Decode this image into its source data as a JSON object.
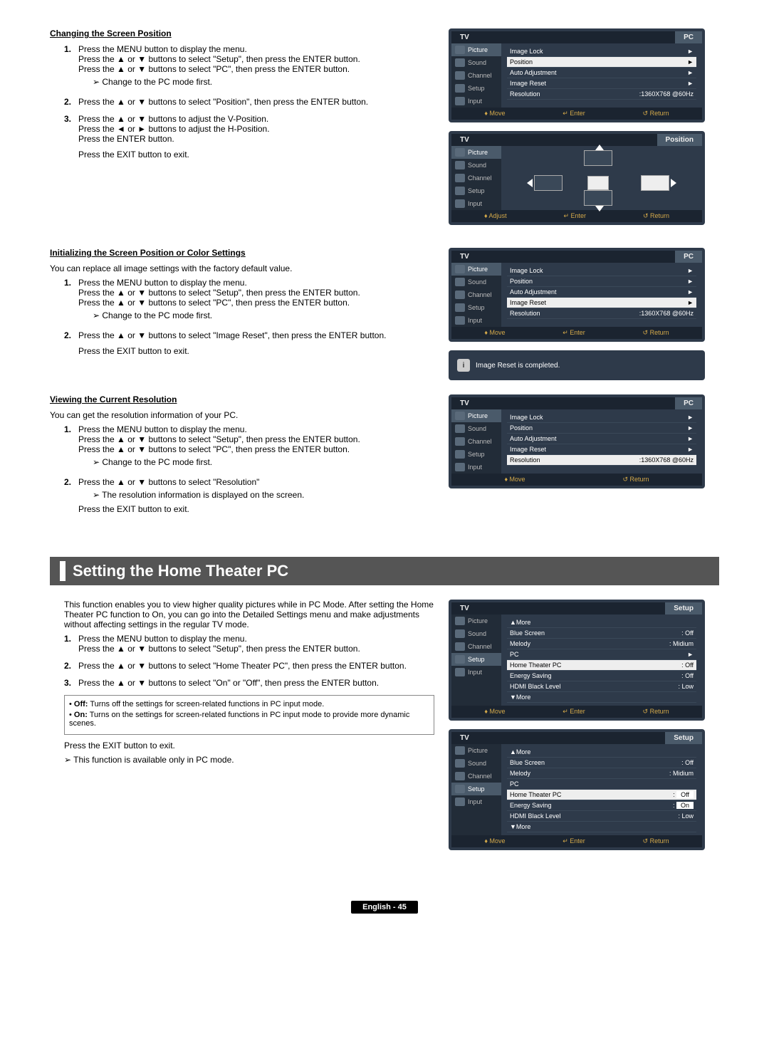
{
  "section1": {
    "title": "Changing the Screen Position",
    "step1": "Press the MENU button to display the menu.\nPress the ▲ or ▼ buttons to select \"Setup\", then press the ENTER button.\nPress the ▲ or ▼ buttons to select \"PC\", then press the ENTER button.",
    "note1": "Change to the PC mode first.",
    "step2": "Press the ▲ or ▼ buttons to select \"Position\", then press the ENTER button.",
    "step3": "Press the ▲ or ▼ buttons to adjust the V-Position.\nPress the ◄ or ► buttons to adjust the H-Position.\nPress the ENTER button.",
    "step3b": "Press the EXIT button to exit."
  },
  "section2": {
    "title": "Initializing the Screen Position or Color Settings",
    "intro": "You can replace all image settings with the factory default value.",
    "step1": "Press the MENU button to display the menu.\nPress the ▲ or ▼ buttons to select \"Setup\", then press the ENTER button.\nPress the ▲ or ▼ buttons to select \"PC\", then press the ENTER button.",
    "note1": "Change to the PC mode first.",
    "step2": "Press the ▲ or ▼ buttons to select \"Image Reset\", then press the ENTER button.",
    "step2b": "Press the EXIT button to exit."
  },
  "section3": {
    "title": "Viewing the Current Resolution",
    "intro": "You can get the resolution information of your PC.",
    "step1": "Press the MENU button to display the menu.\nPress the ▲ or ▼ buttons to select \"Setup\", then press the ENTER button.\nPress the ▲ or ▼ buttons to select \"PC\", then press the ENTER button.",
    "note1": "Change to the PC mode first.",
    "step2": "Press the ▲ or ▼ buttons to select \"Resolution\"",
    "note2": "The resolution information is displayed on the screen.",
    "step2b": "Press the EXIT button to exit."
  },
  "section4": {
    "title": "Setting the Home Theater PC",
    "intro": "This function enables you to view higher quality pictures while in PC Mode. After setting the Home Theater PC function to On, you can go into the Detailed Settings menu and make adjustments without affecting settings in the regular TV mode.",
    "step1": "Press the MENU button to display the menu.\nPress the ▲ or ▼ buttons to select \"Setup\", then press the ENTER button.",
    "step2": "Press the ▲ or ▼ buttons to select \"Home Theater PC\", then press the ENTER button.",
    "step3": "Press the ▲ or ▼ buttons to select \"On\" or \"Off\", then press the ENTER button.",
    "bullet_off": "Off: Turns off the settings for screen-related functions in PC input mode.",
    "bullet_on": "On: Turns on the settings for screen-related functions in PC input mode to provide more dynamic scenes.",
    "step_exit": "Press the EXIT button to exit.",
    "note_final": "This function is available only in PC mode."
  },
  "osd": {
    "tv": "TV",
    "pc": "PC",
    "setup": "Setup",
    "position_title": "Position",
    "side": {
      "picture": "Picture",
      "sound": "Sound",
      "channel": "Channel",
      "setup": "Setup",
      "input": "Input"
    },
    "pc_menu": {
      "image_lock": "Image Lock",
      "position": "Position",
      "auto_adjustment": "Auto Adjustment",
      "image_reset": "Image Reset",
      "resolution": "Resolution",
      "resolution_val": ":1360X768 @60Hz"
    },
    "setup_menu": {
      "more": "▲More",
      "blue_screen": "Blue Screen",
      "blue_screen_val": ": Off",
      "melody": "Melody",
      "melody_val": ": Midium",
      "pc": "PC",
      "htpc": "Home Theater PC",
      "htpc_val": ": Off",
      "energy": "Energy Saving",
      "energy_val": ": Off",
      "hdmi": "HDMI Black Level",
      "hdmi_val": ": Low",
      "more2": "▼More",
      "opt_off": "Off",
      "opt_on": "On"
    },
    "foot": {
      "move": "♦ Move",
      "adjust": "♦ Adjust",
      "enter": "↵ Enter",
      "return": "↺ Return"
    },
    "msg": "Image Reset is completed."
  },
  "footer": "English - 45"
}
